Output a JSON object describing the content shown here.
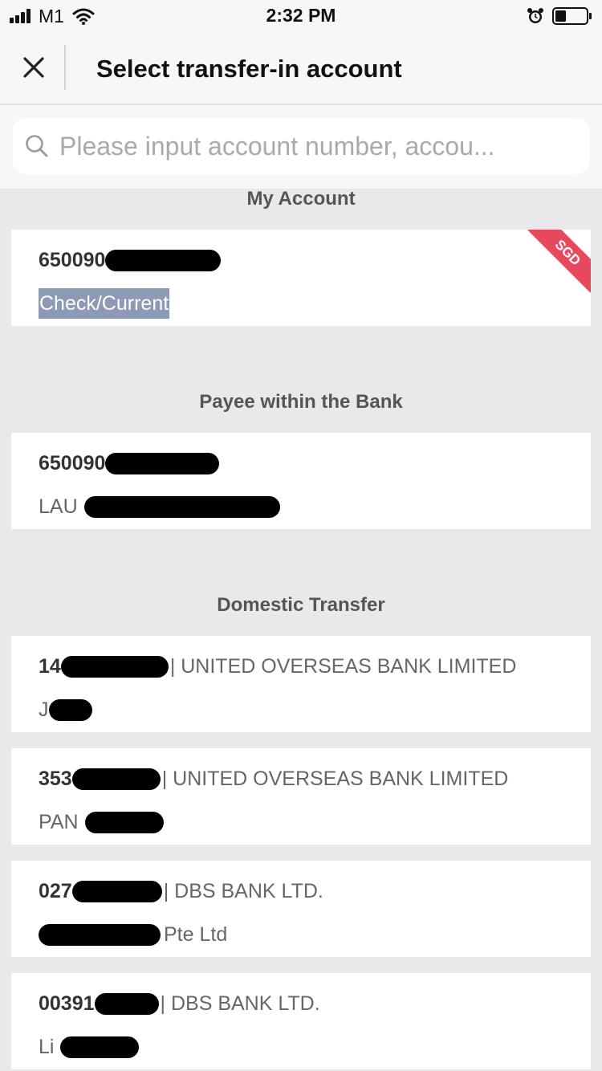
{
  "status_bar": {
    "carrier": "M1",
    "time": "2:32 PM",
    "icons": [
      "signal-icon",
      "wifi-icon",
      "alarm-icon",
      "battery-icon"
    ]
  },
  "header": {
    "title": "Select transfer-in account",
    "close_icon": "close-icon"
  },
  "search": {
    "placeholder": "Please input account number, accou..."
  },
  "sections": {
    "my_account": {
      "title": "My Account",
      "items": [
        {
          "account_prefix": "650090",
          "account_type": "Check/Current",
          "currency": "SGD"
        }
      ]
    },
    "payee_within_bank": {
      "title": "Payee within the Bank",
      "items": [
        {
          "account_prefix": "650090",
          "name_prefix": "LAU"
        }
      ]
    },
    "domestic_transfer": {
      "title": "Domestic Transfer",
      "items": [
        {
          "account_prefix": "14",
          "bank": "| UNITED OVERSEAS BANK LIMITED",
          "name_prefix": "J",
          "name_suffix": ""
        },
        {
          "account_prefix": "353",
          "bank": "| UNITED OVERSEAS BANK LIMITED",
          "name_prefix": "PAN",
          "name_suffix": ""
        },
        {
          "account_prefix": "027",
          "bank": "| DBS BANK LTD.",
          "name_prefix": "",
          "name_suffix": "Pte Ltd"
        },
        {
          "account_prefix": "00391",
          "bank": "| DBS BANK LTD.",
          "name_prefix": "Li",
          "name_suffix": ""
        }
      ]
    }
  },
  "colors": {
    "background": "#e9e9ec",
    "account_type_badge": "#8d9ab6",
    "currency_ribbon": "#e8485d"
  }
}
